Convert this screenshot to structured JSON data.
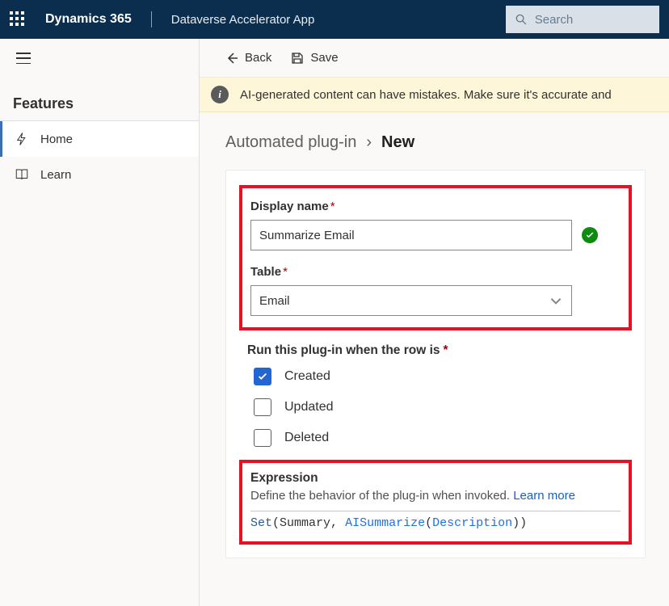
{
  "topbar": {
    "brand": "Dynamics 365",
    "app_name": "Dataverse Accelerator App",
    "search_placeholder": "Search"
  },
  "sidebar": {
    "heading": "Features",
    "items": [
      {
        "label": "Home"
      },
      {
        "label": "Learn"
      }
    ]
  },
  "commands": {
    "back": "Back",
    "save": "Save"
  },
  "warning": {
    "text": "AI-generated content can have mistakes. Make sure it's accurate and"
  },
  "breadcrumb": {
    "parent": "Automated plug-in",
    "current": "New"
  },
  "form": {
    "display_name_label": "Display name",
    "display_name_value": "Summarize Email",
    "table_label": "Table",
    "table_value": "Email",
    "run_when_label": "Run this plug-in when the row is",
    "options": {
      "created": {
        "label": "Created",
        "checked": true
      },
      "updated": {
        "label": "Updated",
        "checked": false
      },
      "deleted": {
        "label": "Deleted",
        "checked": false
      }
    },
    "expression": {
      "title": "Expression",
      "desc": "Define the behavior of the plug-in when invoked.",
      "learn_more": "Learn more",
      "code": {
        "set": "Set",
        "out": "Summary",
        "fn": "AISummarize",
        "arg": "Description"
      }
    }
  }
}
